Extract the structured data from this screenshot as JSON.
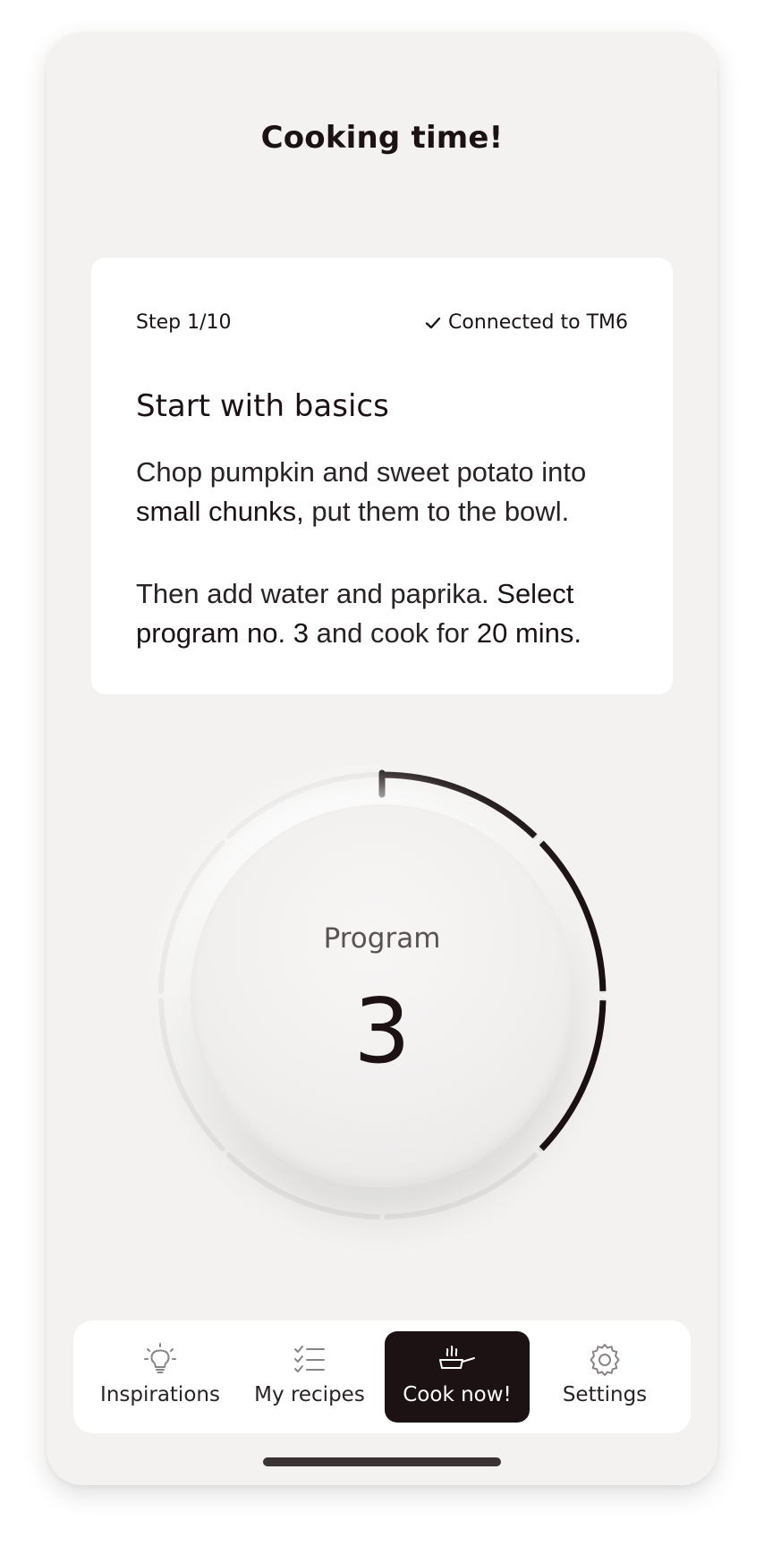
{
  "header": {
    "title": "Cooking time!"
  },
  "card": {
    "step": "Step 1/10",
    "connection": "Connected to TM6",
    "heading": "Start with basics",
    "p1_part1": "Chop pumpkin and sweet potato into ",
    "p1_bold1": "small chunks,",
    "p1_part2": " put them to the bowl.",
    "p2_part1": "Then add water and paprika. ",
    "p2_bold1": "Select program no. 3",
    "p2_part2": " and cook for ",
    "p2_bold2": "20 mins."
  },
  "dial": {
    "label": "Program",
    "value": "3",
    "progress_fraction": 0.375
  },
  "nav": {
    "items": [
      {
        "label": "Inspirations",
        "icon": "lightbulb-icon",
        "active": false
      },
      {
        "label": "My recipes",
        "icon": "checklist-icon",
        "active": false
      },
      {
        "label": "Cook now!",
        "icon": "cooking-pan-icon",
        "active": true
      },
      {
        "label": "Settings",
        "icon": "gear-icon",
        "active": false
      }
    ]
  },
  "colors": {
    "background": "#f3f2f1",
    "card": "#ffffff",
    "accent_dark": "#1c1214",
    "muted_text": "#5b5254"
  }
}
